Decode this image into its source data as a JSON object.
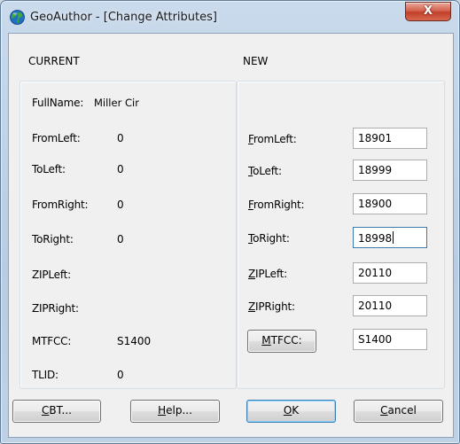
{
  "window": {
    "title": "GeoAuthor - [Change Attributes]",
    "close_glyph": "X",
    "app_icon": "globe-icon"
  },
  "current": {
    "heading": "CURRENT",
    "fullname_label": "FullName:",
    "fullname_value": "Miller Cir",
    "rows": [
      {
        "label": "FromLeft:",
        "value": "0"
      },
      {
        "label": "ToLeft:",
        "value": "0"
      },
      {
        "label": "FromRight:",
        "value": "0"
      },
      {
        "label": "ToRight:",
        "value": "0"
      },
      {
        "label": "ZIPLeft:",
        "value": ""
      },
      {
        "label": "ZIPRight:",
        "value": ""
      },
      {
        "label": "MTFCC:",
        "value": "S1400"
      },
      {
        "label": "TLID:",
        "value": "0"
      }
    ]
  },
  "new": {
    "heading": "NEW",
    "rows": [
      {
        "label_first": "F",
        "label_rest": "romLeft:",
        "value": "18901"
      },
      {
        "label_first": "T",
        "label_rest": "oLeft:",
        "value": "18999"
      },
      {
        "label_first": "F",
        "label_rest": "romRight:",
        "value": "18900"
      },
      {
        "label_first": "T",
        "label_rest": "oRight:",
        "value": "18998"
      },
      {
        "label_first": "Z",
        "label_rest": "IPLeft:",
        "value": "20110"
      },
      {
        "label_first": "Z",
        "label_rest": "IPRight:",
        "value": "20110"
      }
    ],
    "mtfcc_button": {
      "label_first": "M",
      "label_rest": "TFCC:"
    },
    "mtfcc_value": "S1400"
  },
  "buttons": {
    "cbt": {
      "first": "C",
      "rest": "BT..."
    },
    "help": {
      "first": "H",
      "rest": "elp..."
    },
    "ok": {
      "first": "O",
      "rest": "K"
    },
    "cancel": {
      "first": "C",
      "rest": "ancel"
    }
  },
  "colors": {
    "title_bar": "#c9daec",
    "close_button": "#c2402a",
    "dialog_face": "#f0f0f0",
    "default_button_border": "#3c7fb1"
  }
}
